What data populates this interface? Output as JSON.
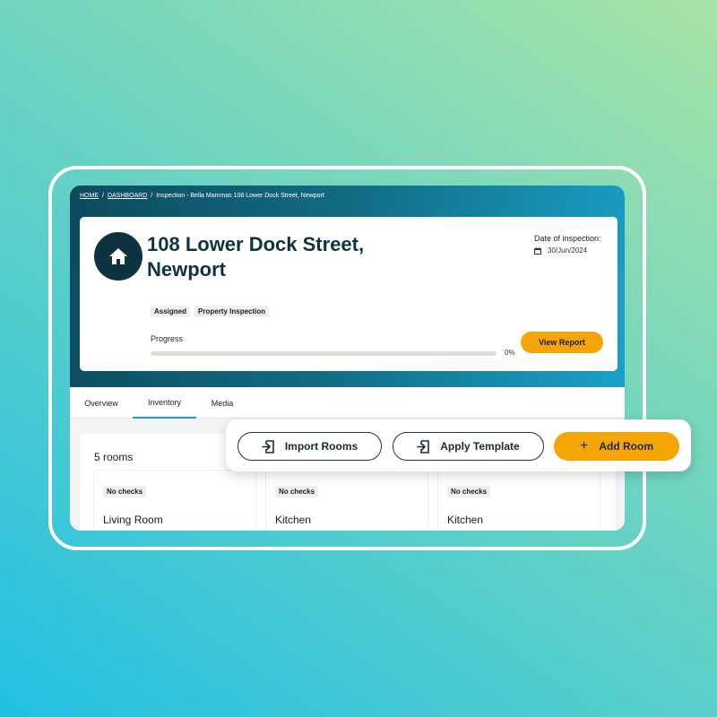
{
  "breadcrumb": {
    "home": "HOME",
    "sep1": "/",
    "dashboard": "DASHBOARD",
    "sep2": "/",
    "current": "Inspection - Bella Mammas 108 Lower Dock Street, Newport"
  },
  "property": {
    "title_line1": "108 Lower Dock Street,",
    "title_line2": "Newport",
    "date_label": "Date of inspection:",
    "date_value": "30/Jun/2024",
    "tags": [
      "Assigned",
      "Property Inspection"
    ],
    "progress_label": "Progress",
    "progress_percent": 0,
    "progress_text": "0%",
    "view_report_label": "View Report"
  },
  "tabs": [
    {
      "label": "Overview",
      "active": false
    },
    {
      "label": "Inventory",
      "active": true
    },
    {
      "label": "Media",
      "active": false
    }
  ],
  "rooms": {
    "count_label": "5 rooms",
    "items": [
      {
        "badge": "No checks",
        "name": "Living Room"
      },
      {
        "badge": "No checks",
        "name": "Kitchen"
      },
      {
        "badge": "No checks",
        "name": "Kitchen"
      }
    ]
  },
  "actions": {
    "import_rooms": "Import Rooms",
    "apply_template": "Apply Template",
    "add_room": "Add Room",
    "add_icon": "+"
  },
  "colors": {
    "accent": "#f6a507",
    "brand_dark": "#0e3340",
    "hero_start": "#0d4a5e",
    "hero_end": "#1aa1c9",
    "tab_underline": "#1aa1c9"
  },
  "icons": {
    "home": "home-icon",
    "calendar": "calendar-icon",
    "import": "import-icon",
    "template": "apply-template-icon",
    "add": "plus-icon"
  }
}
